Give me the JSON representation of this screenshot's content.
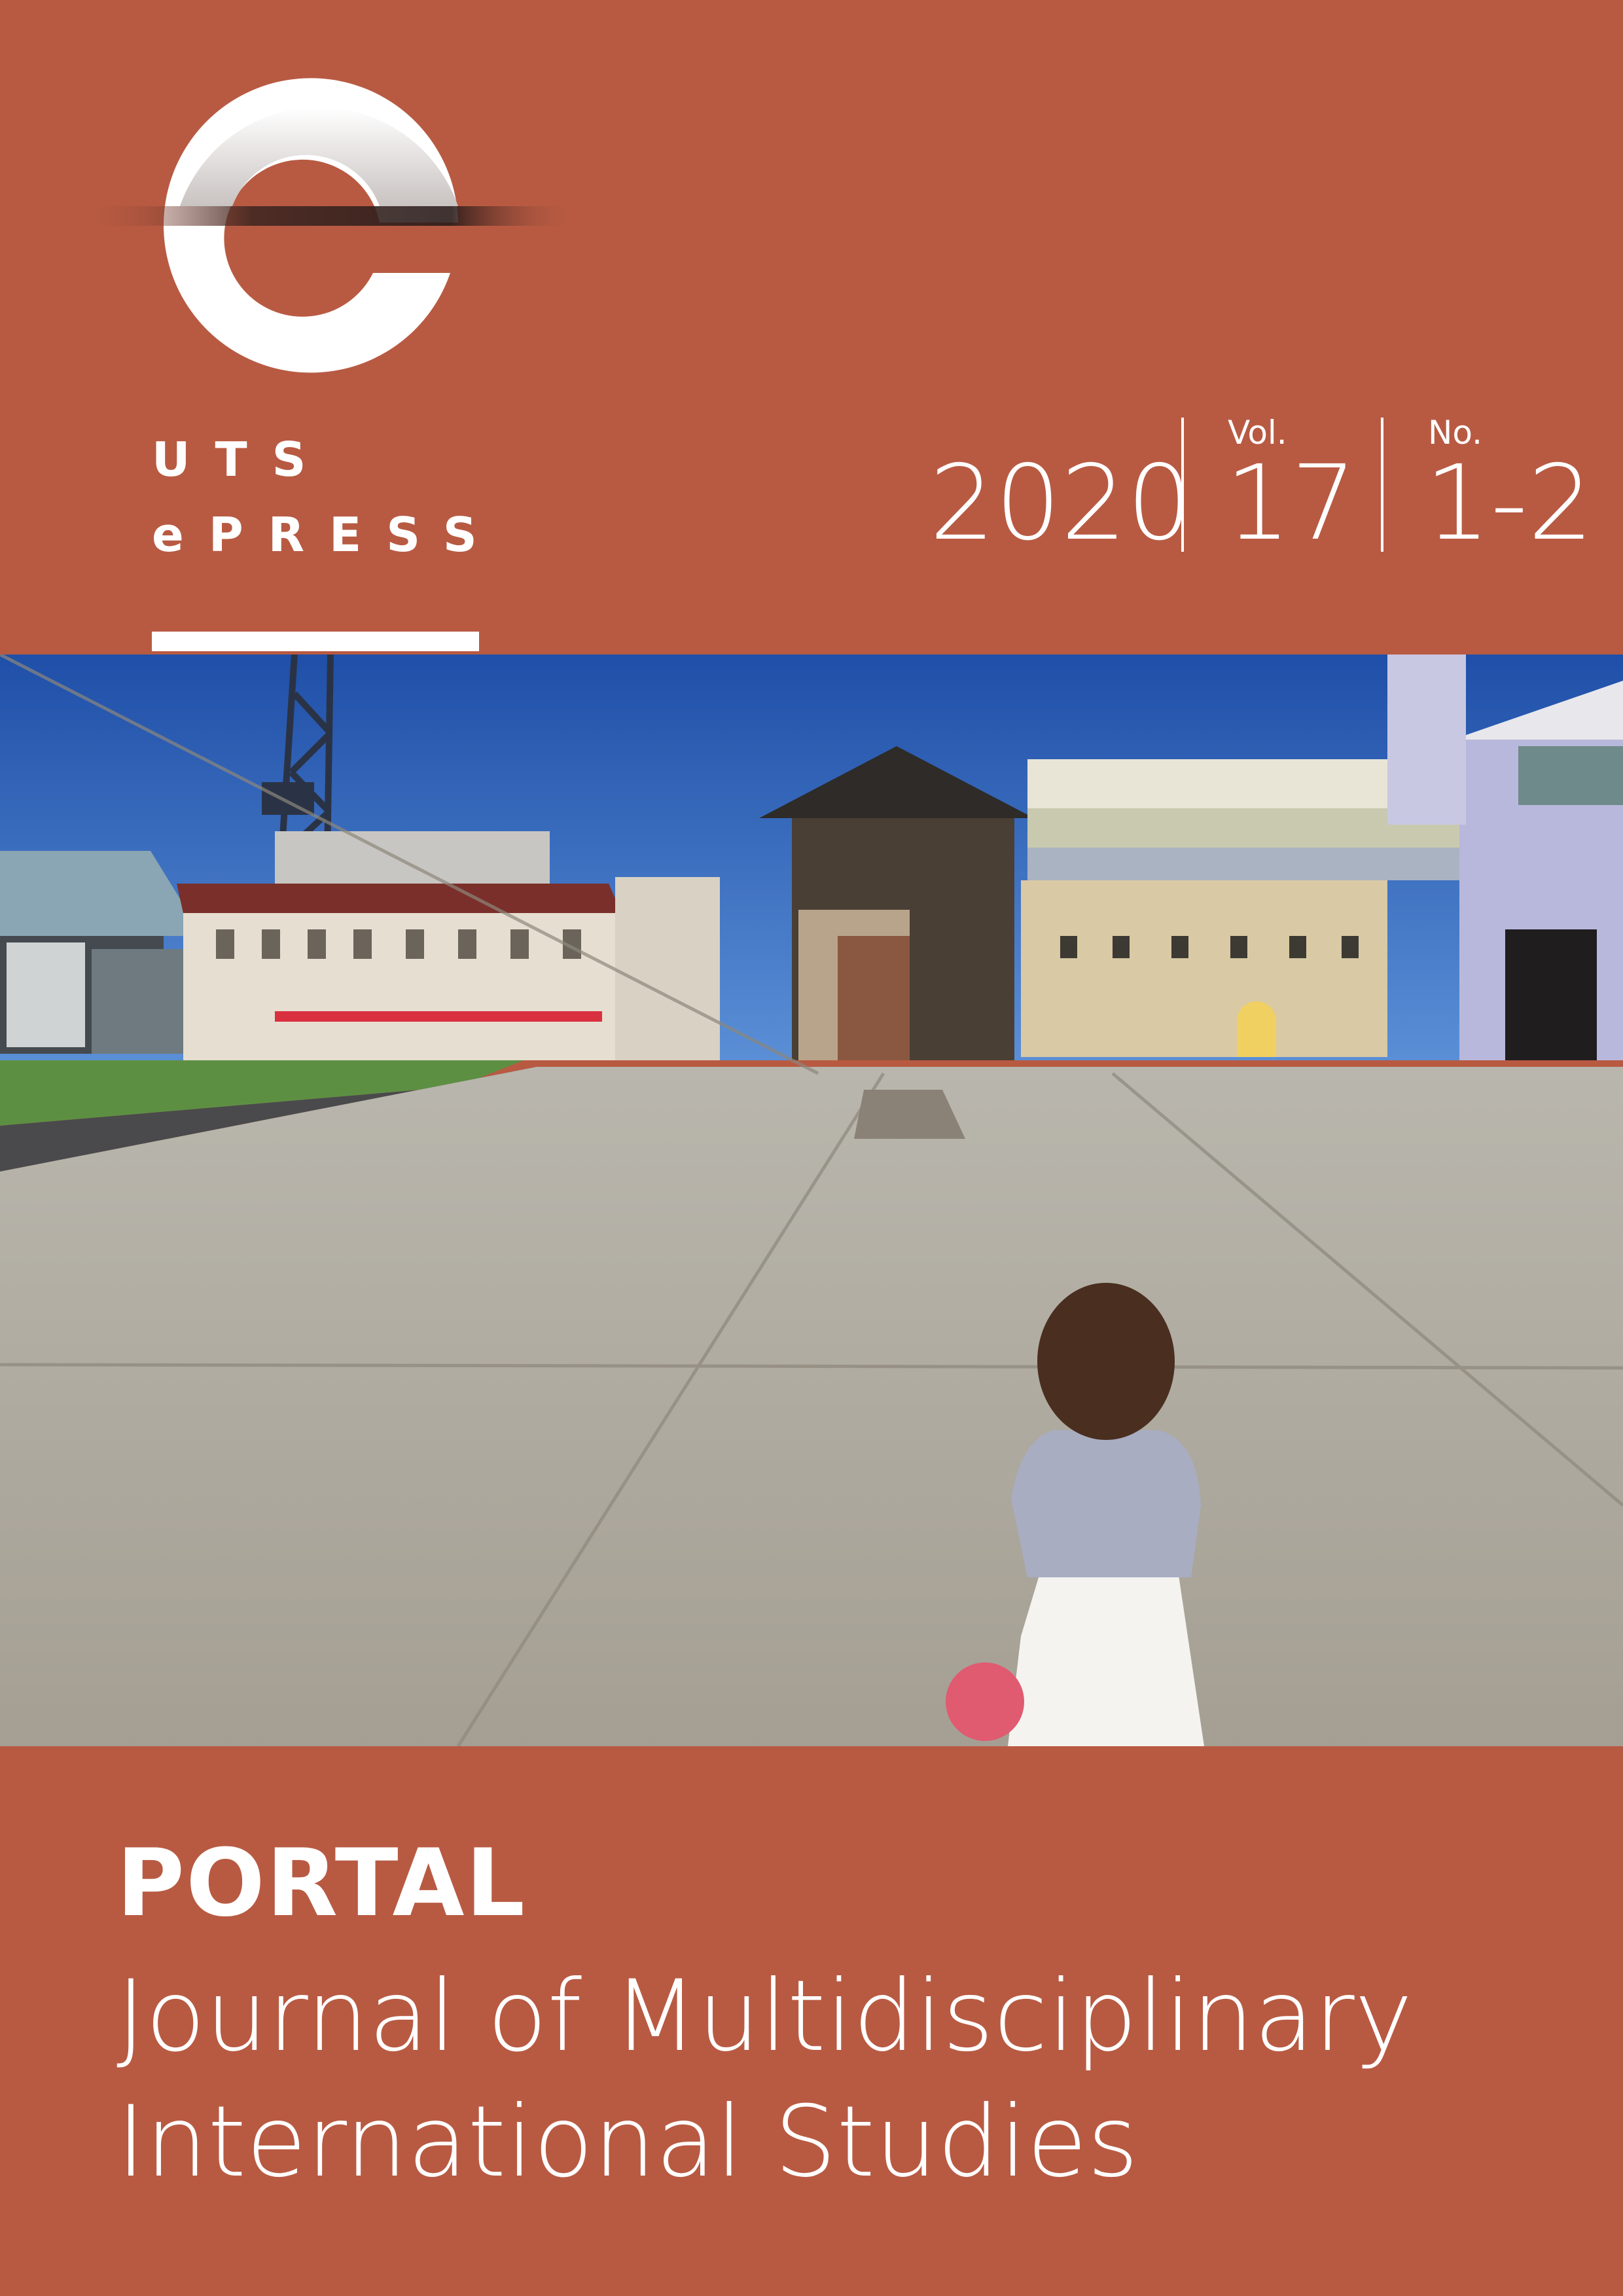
{
  "publisher": {
    "line1": "UTS",
    "line2": "ePRESS"
  },
  "issue": {
    "year": "2020",
    "volume_label": "Vol.",
    "volume": "17",
    "number_label": "No.",
    "number": "1-2"
  },
  "journal": {
    "title": "PORTAL",
    "subtitle_line1": "Journal of Multidisciplinary",
    "subtitle_line2": "International Studies"
  },
  "colors": {
    "background": "#b85a42",
    "text": "#ffffff"
  }
}
